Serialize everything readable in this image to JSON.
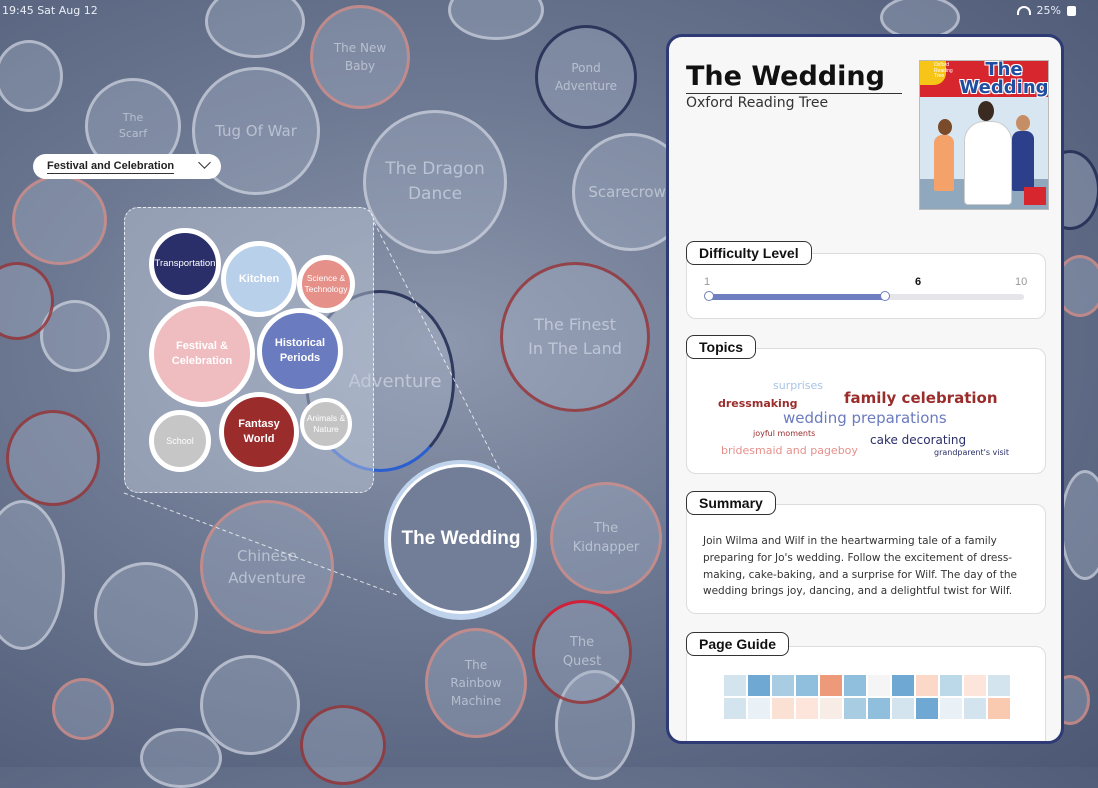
{
  "status": {
    "time": "19:45 Sat Aug 12",
    "battery": "25%"
  },
  "filter": {
    "selected": "Festival and Celebration"
  },
  "background_books": [
    {
      "label": "The New Baby"
    },
    {
      "label": "The Scarf"
    },
    {
      "label": "Tug Of War"
    },
    {
      "label": "The Dragon Dance"
    },
    {
      "label": "Pond Adventure"
    },
    {
      "label": "Scarecrows"
    },
    {
      "label": "The Finest In The Land"
    },
    {
      "label": "Adventure"
    },
    {
      "label": "Chinese Adventure"
    },
    {
      "label": "The Kidnapper"
    },
    {
      "label": "The Quest"
    },
    {
      "label": "The Rainbow Machine"
    }
  ],
  "categories": [
    {
      "label": "Transportation",
      "color": "#2a2f6a"
    },
    {
      "label": "Kitchen",
      "color": "#b9d0ea"
    },
    {
      "label": "Science & Technology",
      "color": "#e6908a"
    },
    {
      "label": "Festival & Celebration",
      "color": "#efbcc0"
    },
    {
      "label": "Historical Periods",
      "color": "#6a7bbf"
    },
    {
      "label": "School",
      "color": "#c6c6c6"
    },
    {
      "label": "Fantasy World",
      "color": "#9a2c2c"
    },
    {
      "label": "Animals & Nature",
      "color": "#c4c4c4"
    }
  ],
  "selected_book": {
    "label": "The Wedding"
  },
  "panel": {
    "title": "The Wedding",
    "series": "Oxford Reading Tree",
    "cover": {
      "title": "The Wedding",
      "brand": "Oxford Reading Tree"
    },
    "difficulty": {
      "label": "Difficulty Level",
      "min": "1",
      "max": "10",
      "value": "6",
      "fraction": 0.56
    },
    "topics": {
      "label": "Topics",
      "words": [
        {
          "text": "surprises",
          "color": "#a8c4e6",
          "size": 11
        },
        {
          "text": "family celebration",
          "color": "#9a2c2c",
          "size": 15
        },
        {
          "text": "dressmaking",
          "color": "#9a2c2c",
          "size": 11
        },
        {
          "text": "wedding preparations",
          "color": "#6a7bbf",
          "size": 15
        },
        {
          "text": "joyful moments",
          "color": "#9a2c2c",
          "size": 8
        },
        {
          "text": "cake decorating",
          "color": "#2a2f6a",
          "size": 12
        },
        {
          "text": "bridesmaid and pageboy",
          "color": "#e6908a",
          "size": 11
        },
        {
          "text": "grandparent's visit",
          "color": "#2a2f6a",
          "size": 8
        }
      ]
    },
    "summary": {
      "label": "Summary",
      "text": "Join Wilma and Wilf in the heartwarming tale of a family preparing for Jo's wedding. Follow the excitement of dress-making, cake-baking, and a surprise for Wilf. The day of the wedding brings joy, dancing, and a delightful twist for Wilf."
    },
    "page_guide": {
      "label": "Page Guide",
      "cells": [
        "#d3e4ef",
        "#6fa8d2",
        "#a8cde3",
        "#8fbfdc",
        "#ec9a7a",
        "#8fbfdc",
        "#f5f5f5",
        "#6fa8d2",
        "#fbd8c7",
        "#bcd9e9",
        "#fde5db",
        "#d3e4ef",
        "#d3e4ef",
        "#e9f1f7",
        "#fbe1d4",
        "#fde5db",
        "#f8ece6",
        "#a8cde3",
        "#8fbfdc",
        "#d3e4ef",
        "#6fa8d2",
        "#e9f1f7",
        "#d3e4ef",
        "#f9c9b0"
      ]
    }
  }
}
